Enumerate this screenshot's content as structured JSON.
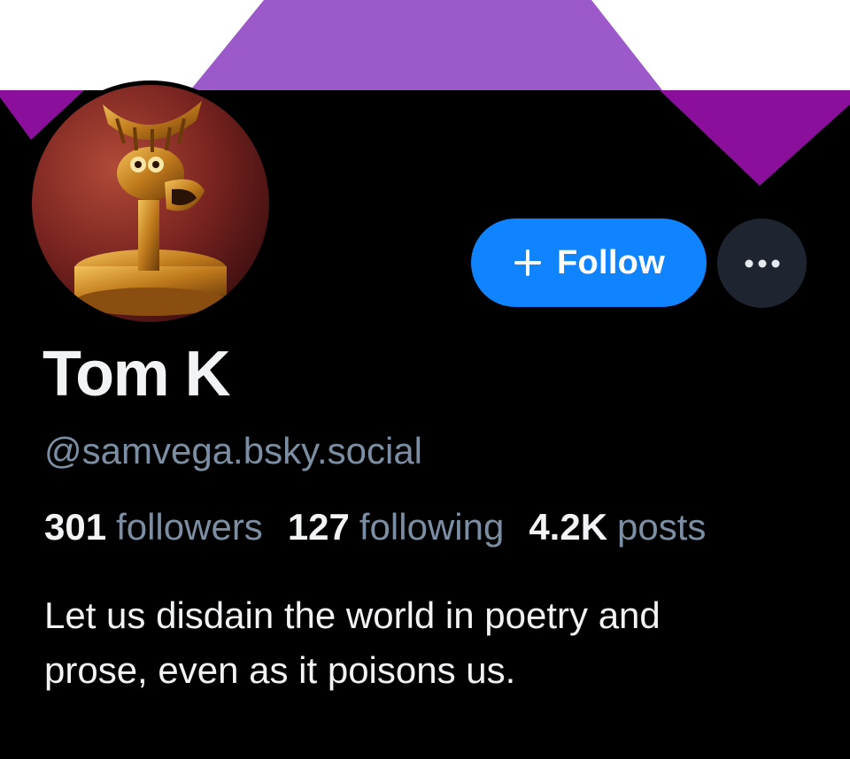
{
  "banner": {
    "colors": {
      "top_background": "#ffffff",
      "bottom_band": "#000000",
      "light_purple": "#9b59c9",
      "dark_purple": "#8a0f9a"
    }
  },
  "avatar": {
    "icon": "robot-avatar-icon"
  },
  "actions": {
    "follow_label": "Follow",
    "follow_icon": "plus-icon",
    "more_icon": "more-options-icon",
    "follow_color": "#1083fe"
  },
  "profile": {
    "display_name": "Tom K",
    "handle": "@samvega.bsky.social",
    "stats": {
      "followers_count": "301",
      "followers_label": "followers",
      "following_count": "127",
      "following_label": "following",
      "posts_count": "4.2K",
      "posts_label": "posts"
    },
    "bio_line1": "Let us disdain the world in poetry and",
    "bio_line2": "prose, even as it poisons us."
  }
}
